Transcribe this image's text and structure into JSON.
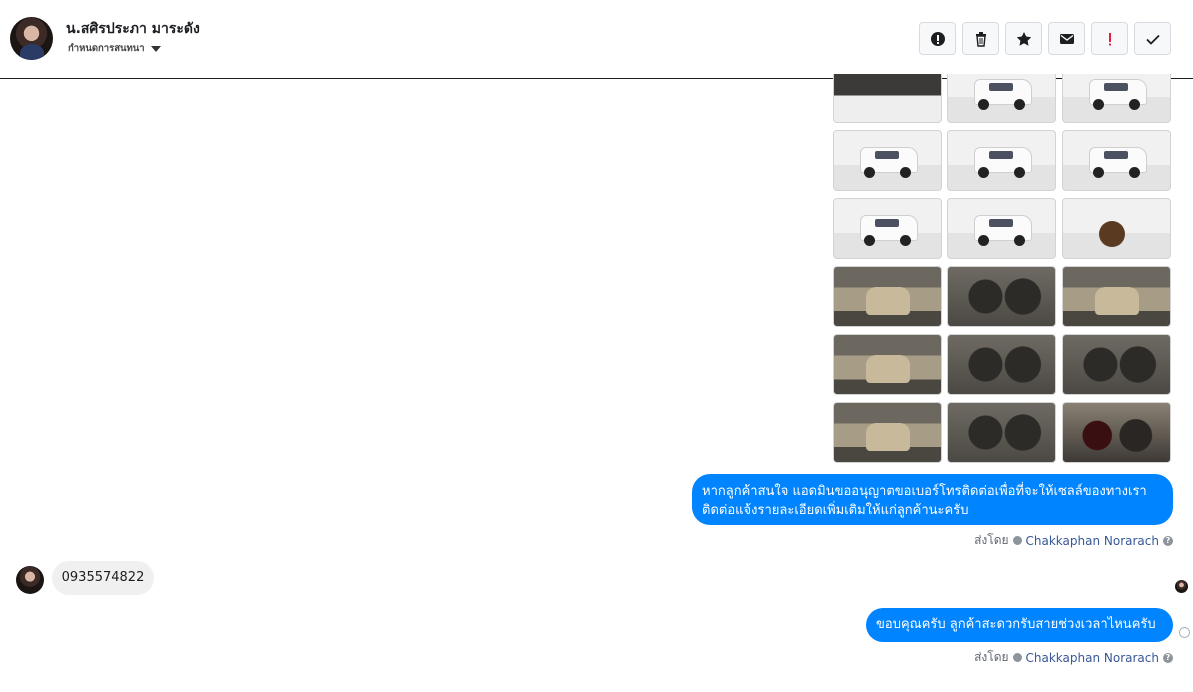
{
  "header": {
    "name": "น.สศิรประภา มาระดัง",
    "subline": "กำหนดการสนทนา"
  },
  "toolbar": {
    "actions": [
      {
        "icon": "info-circle-icon",
        "label": "!"
      },
      {
        "icon": "trash-icon",
        "label": ""
      },
      {
        "icon": "star-icon",
        "label": ""
      },
      {
        "icon": "mail-icon",
        "label": ""
      },
      {
        "icon": "exclamation-icon",
        "label": "!"
      },
      {
        "icon": "check-icon",
        "label": ""
      }
    ]
  },
  "messages": {
    "outgoing_1": "หากลูกค้าสนใจ แอดมินขออนุญาตขอเบอร์โทรติดต่อเพื่อที่จะให้เซลล์ของทางเราติดต่อแจ้งรายละเอียดเพิ่มเติมให้แก่ลูกค้านะครับ",
    "incoming_1": "0935574822",
    "outgoing_2": "ขอบคุณครับ ลูกค้าสะดวกรับสายช่วงเวลาไหนครับ"
  },
  "meta": {
    "sent_by_label": "ส่งโดย",
    "author": "Chakkaphan Norarach"
  },
  "gallery": {
    "photos": [
      "engine-photo",
      "truck-front-photo",
      "truck-front-photo",
      "truck-front-photo",
      "truck-rear-photo",
      "truck-rear-photo",
      "truck-side-photo",
      "truck-side-photo",
      "truck-wheel-photo",
      "interior-door-photo",
      "interior-dash-photo",
      "interior-console-photo",
      "interior-seat-photo",
      "interior-steering-photo",
      "interior-steering-photo",
      "rear-seat-photo",
      "dashboard-photo",
      "gauge-photo"
    ]
  }
}
